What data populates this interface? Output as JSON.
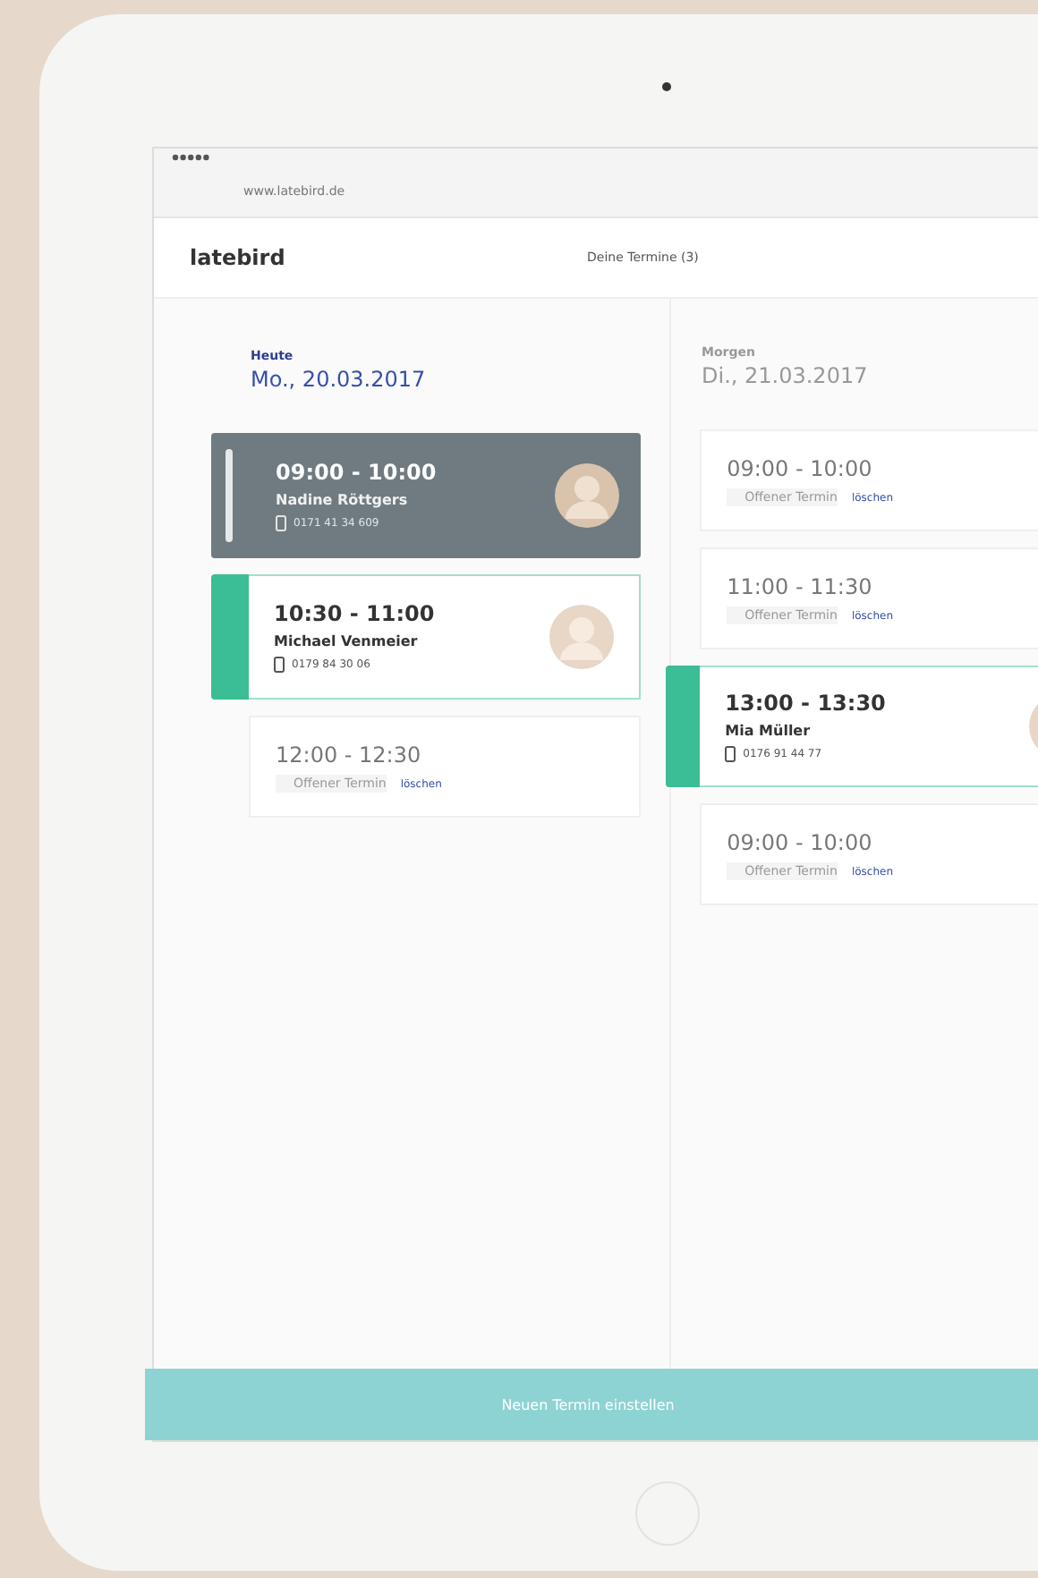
{
  "browser": {
    "url": "www.latebird.de"
  },
  "header": {
    "logo": "latebird",
    "appointments_link": "Deine Termine (3)"
  },
  "days": [
    {
      "label": "Heute",
      "date": "Mo., 20.03.2017",
      "selected": true,
      "slots": [
        {
          "kind": "past",
          "time": "09:00 - 10:00",
          "name": "Nadine Röttgers",
          "phone": "0171 41 34 609"
        },
        {
          "kind": "booked",
          "time": "10:30 - 11:00",
          "name": "Michael Venmeier",
          "phone": "0179 84 30 06"
        },
        {
          "kind": "open",
          "time": "12:00 - 12:30",
          "status": "Offener Termin",
          "action": "löschen"
        }
      ]
    },
    {
      "label": "Morgen",
      "date": "Di., 21.03.2017",
      "selected": false,
      "slots": [
        {
          "kind": "open",
          "time": "09:00 - 10:00",
          "status": "Offener Termin",
          "action": "löschen"
        },
        {
          "kind": "open",
          "time": "11:00 - 11:30",
          "status": "Offener Termin",
          "action": "löschen"
        },
        {
          "kind": "booked",
          "time": "13:00 - 13:30",
          "name": "Mia Müller",
          "phone": "0176 91 44 77"
        },
        {
          "kind": "open",
          "time": "09:00 - 10:00",
          "status": "Offener Termin",
          "action": "löschen"
        }
      ]
    }
  ],
  "footer_button": "Neuen Termin einstellen"
}
